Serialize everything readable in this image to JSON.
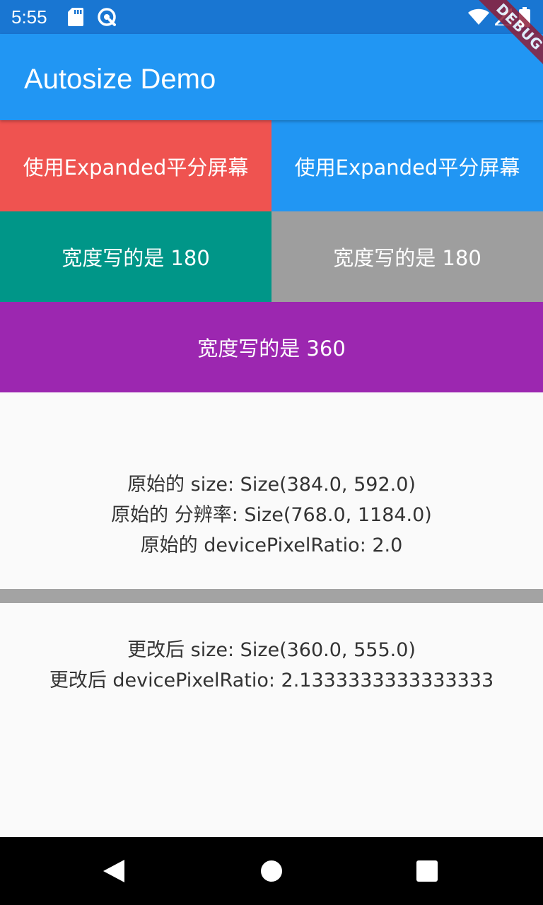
{
  "status_bar": {
    "time": "5:55",
    "icons": [
      "sd-card-icon",
      "data-saver-icon",
      "wifi-icon",
      "signal-icon",
      "battery-icon"
    ]
  },
  "app_bar": {
    "title": "Autosize Demo"
  },
  "debug_banner": {
    "label": "DEBUG"
  },
  "blocks": [
    {
      "label": "使用Expanded平分屏幕",
      "color": "#EF5350"
    },
    {
      "label": "使用Expanded平分屏幕",
      "color": "#2196F3"
    },
    {
      "label": "宽度写的是 180",
      "color": "#009688"
    },
    {
      "label": "宽度写的是 180",
      "color": "#9E9E9E"
    },
    {
      "label": "宽度写的是 360",
      "color": "#9C27B0"
    }
  ],
  "original_info": {
    "size": "原始的 size: Size(384.0, 592.0)",
    "resolution": "原始的 分辨率: Size(768.0, 1184.0)",
    "device_pixel_ratio": "原始的 devicePixelRatio: 2.0"
  },
  "changed_info": {
    "size": "更改后 size: Size(360.0, 555.0)",
    "device_pixel_ratio": "更改后 devicePixelRatio: 2.1333333333333333"
  },
  "nav_bar": {
    "icons": [
      "back-icon",
      "home-icon",
      "recents-icon"
    ]
  },
  "colors": {
    "status_bar": "#1976D2",
    "app_bar": "#2196F3",
    "debug_banner": "#8E1F39",
    "divider": "#A3A3A3",
    "background": "#FAFAFA"
  }
}
